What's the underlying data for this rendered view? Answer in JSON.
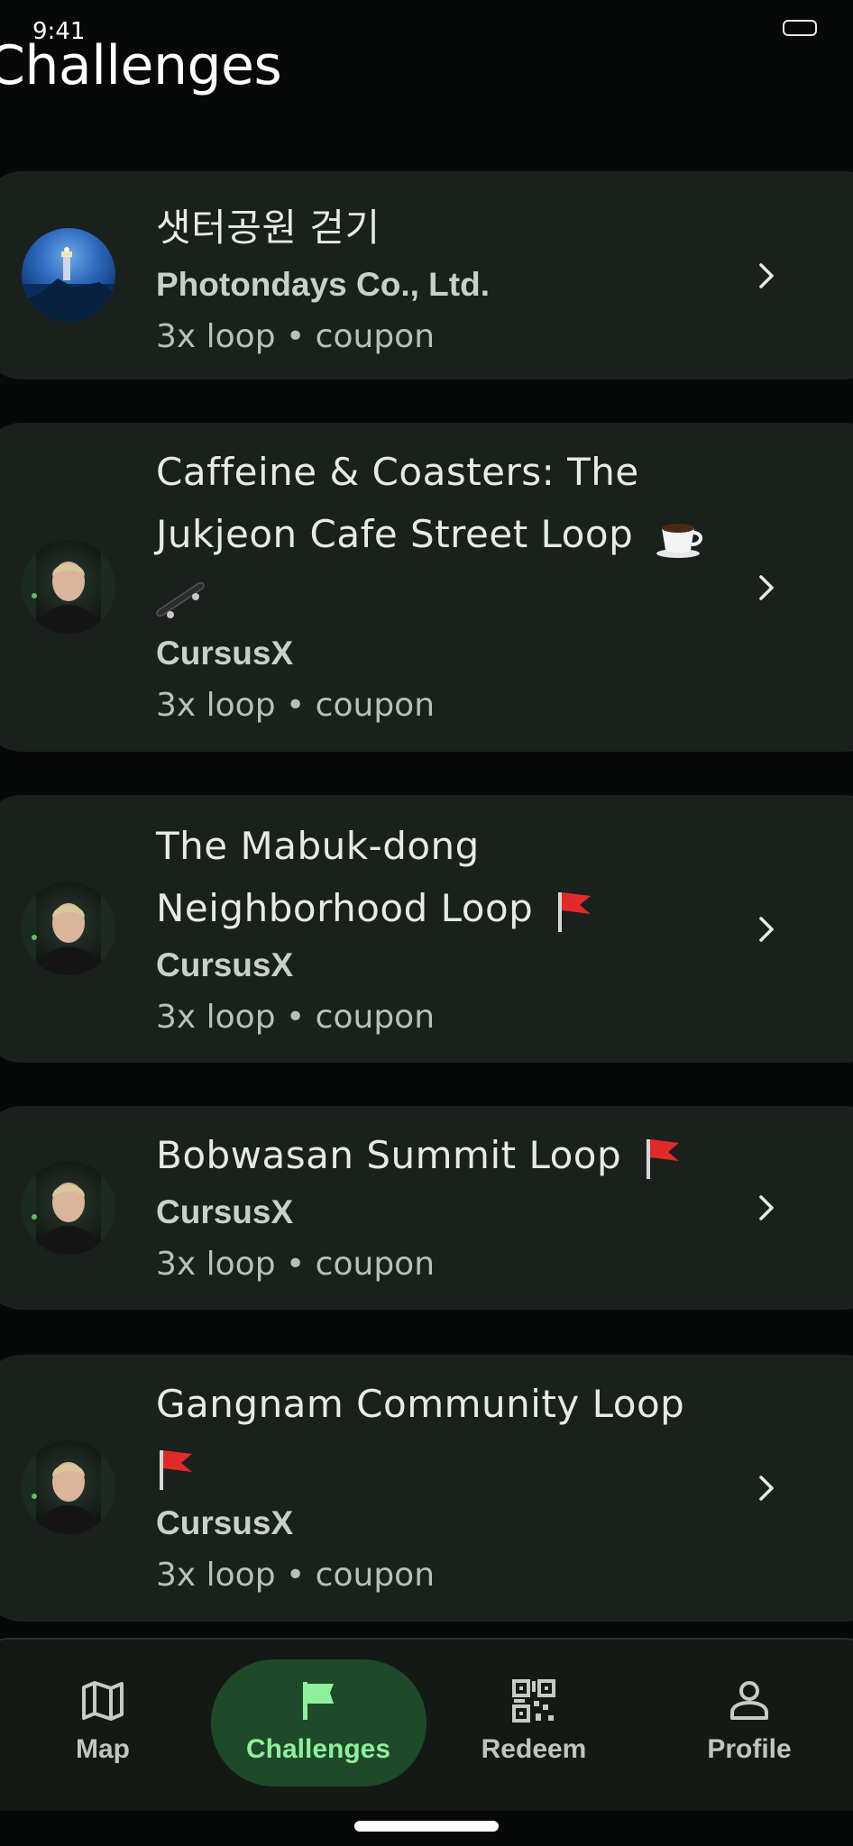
{
  "status_bar": {
    "time": "9:41"
  },
  "header": {
    "title": "Challenges"
  },
  "challenges": [
    {
      "title": "샛터공원 걷기",
      "organizer": "Photondays Co., Ltd.",
      "meta": "3x loop • coupon",
      "avatar": "lighthouse-photo",
      "emoji": ""
    },
    {
      "title": "Caffeine & Coasters: The Jukjeon Cafe Street Loop",
      "organizer": "CursusX",
      "meta": "3x loop • coupon",
      "avatar": "person-photo",
      "emoji": "coffee-skateboard"
    },
    {
      "title": "The Mabuk-dong Neighborhood Loop",
      "organizer": "CursusX",
      "meta": "3x loop • coupon",
      "avatar": "person-photo",
      "emoji": "red-flag"
    },
    {
      "title": "Bobwasan Summit Loop",
      "organizer": "CursusX",
      "meta": "3x loop • coupon",
      "avatar": "person-photo",
      "emoji": "red-flag"
    },
    {
      "title": "Gangnam Community Loop",
      "organizer": "CursusX",
      "meta": "3x loop • coupon",
      "avatar": "person-photo",
      "emoji": "red-flag"
    }
  ],
  "nav": {
    "items": [
      {
        "label": "Map",
        "icon": "map-icon"
      },
      {
        "label": "Challenges",
        "icon": "flag-icon",
        "active": true
      },
      {
        "label": "Redeem",
        "icon": "qr-code-icon"
      },
      {
        "label": "Profile",
        "icon": "person-icon"
      }
    ]
  },
  "colors": {
    "background": "#070808",
    "card": "#1a211c",
    "accent": "#8ff09c",
    "active_pill": "#1f4a2a"
  }
}
